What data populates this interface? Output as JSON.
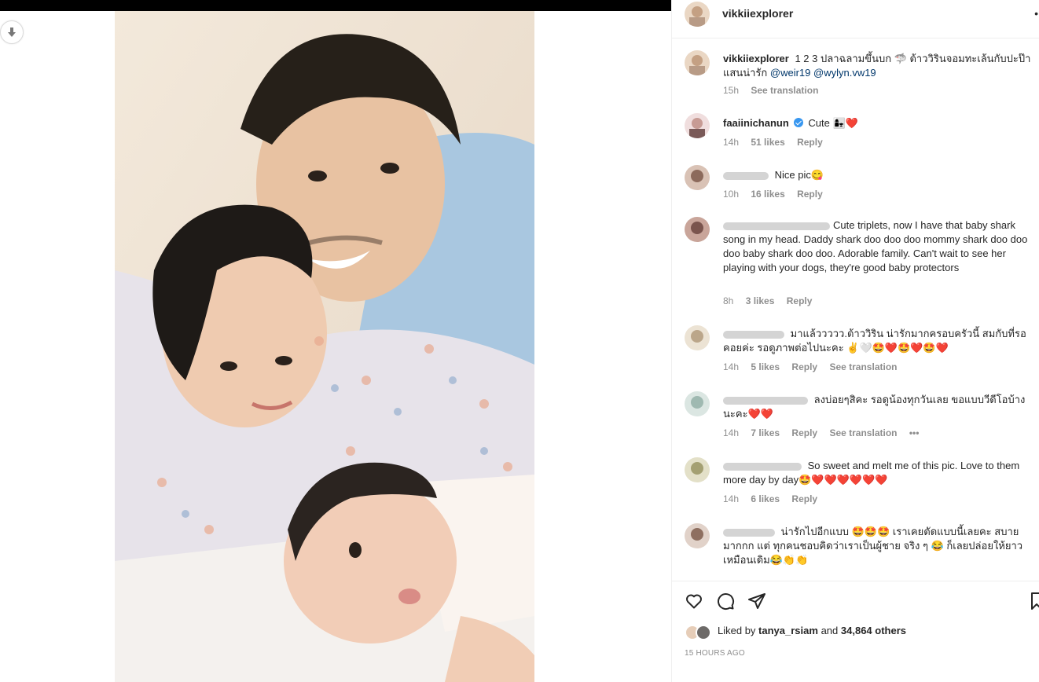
{
  "post": {
    "username": "vikkiiexplorer",
    "more_label": "•"
  },
  "caption": {
    "username": "vikkiiexplorer",
    "text": "1 2 3 ปลาฉลามขึ้นบก 🦈 ต้าววิรินจอมทะเล้นกับปะป๊าแสนน่ารัก",
    "mention1": "@weir19",
    "mention2": "@wylyn.vw19",
    "time": "15h",
    "see_translation": "See translation"
  },
  "comments": [
    {
      "username": "faaiinichanun",
      "verified": true,
      "text": "Cute 👩‍👧❤️",
      "time": "14h",
      "likes": "51 likes",
      "reply": "Reply"
    },
    {
      "username": "",
      "text": "Nice pic😋",
      "time": "10h",
      "likes": "16 likes",
      "reply": "Reply"
    },
    {
      "username": "",
      "text": "Cute triplets, now I have that baby shark song in my head. Daddy shark doo doo doo mommy shark doo doo doo baby shark doo doo. Adorable family. Can't wait to see her playing with your dogs, they're good baby protectors",
      "time": "8h",
      "likes": "3 likes",
      "reply": "Reply"
    },
    {
      "username": "",
      "text": "มาแล้ววววว.ต้าววิริน น่ารักมากครอบครัวนี้ สมกับที่รอคอยค่ะ รอดูภาพต่อไปนะคะ ✌️🤍🤩❤️🤩❤️🤩❤️",
      "time": "14h",
      "likes": "5 likes",
      "reply": "Reply",
      "see_translation": "See translation"
    },
    {
      "username": "",
      "text": "ลงบ่อยๆสิคะ รอดูน้องทุกวันเลย ขอแบบวีดีโอบ้างนะคะ❤️❤️",
      "time": "14h",
      "likes": "7 likes",
      "reply": "Reply",
      "see_translation": "See translation",
      "more": "•••"
    },
    {
      "username": "",
      "text": "So sweet and melt me of this pic. Love to them more day by day🤩❤️❤️❤️❤️❤️❤️",
      "time": "14h",
      "likes": "6 likes",
      "reply": "Reply"
    },
    {
      "username": "",
      "text": "น่ารักไปอีกแบบ 🤩🤩🤩 เราเคยตัดแบบนี้เลยคะ สบายมากกก แต่ ทุกคนชอบคิดว่าเราเป็นผู้ชาย จริง ๆ 😂 ก็เลยปล่อยให้ยาวเหมือนเดิม😂👏👏",
      "time": "",
      "likes": "",
      "reply": ""
    }
  ],
  "footer": {
    "liked_by_prefix": "Liked by",
    "liked_by_user": "tanya_rsiam",
    "liked_by_and": "and",
    "liked_by_others": "34,864 others",
    "time_ago": "15 HOURS AGO"
  },
  "icons": [
    "download-icon",
    "heart-icon",
    "comment-icon",
    "share-icon",
    "save-icon",
    "verified-icon"
  ],
  "colors": {
    "mention": "#00376b",
    "meta": "#8e8e8e",
    "verified": "#3897f0"
  }
}
